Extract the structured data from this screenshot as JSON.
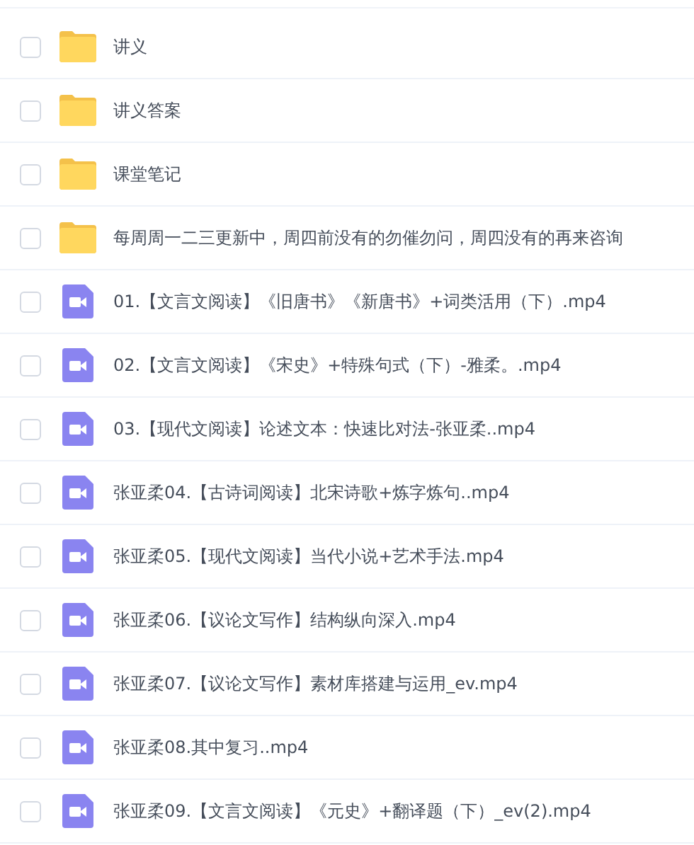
{
  "files": [
    {
      "kind": "folder",
      "name": "讲义",
      "checked": false
    },
    {
      "kind": "folder",
      "name": "讲义答案",
      "checked": false
    },
    {
      "kind": "folder",
      "name": "课堂笔记",
      "checked": false
    },
    {
      "kind": "folder",
      "name": "每周周一二三更新中，周四前没有的勿催勿问，周四没有的再来咨询",
      "checked": false
    },
    {
      "kind": "video",
      "name": "01.【文言文阅读】《旧唐书》《新唐书》+词类活用（下）.mp4",
      "checked": false
    },
    {
      "kind": "video",
      "name": "02.【文言文阅读】《宋史》+特殊句式（下）-雅柔。.mp4",
      "checked": false
    },
    {
      "kind": "video",
      "name": "03.【现代文阅读】论述文本：快速比对法-张亚柔..mp4",
      "checked": false
    },
    {
      "kind": "video",
      "name": "张亚柔04.【古诗词阅读】北宋诗歌+炼字炼句..mp4",
      "checked": false
    },
    {
      "kind": "video",
      "name": "张亚柔05.【现代文阅读】当代小说+艺术手法.mp4",
      "checked": false
    },
    {
      "kind": "video",
      "name": "张亚柔06.【议论文写作】结构纵向深入.mp4",
      "checked": false
    },
    {
      "kind": "video",
      "name": "张亚柔07.【议论文写作】素材库搭建与运用_ev.mp4",
      "checked": false
    },
    {
      "kind": "video",
      "name": "张亚柔08.其中复习..mp4",
      "checked": false
    },
    {
      "kind": "video",
      "name": "张亚柔09.【文言文阅读】《元史》+翻译题（下）_ev(2).mp4",
      "checked": false
    }
  ]
}
